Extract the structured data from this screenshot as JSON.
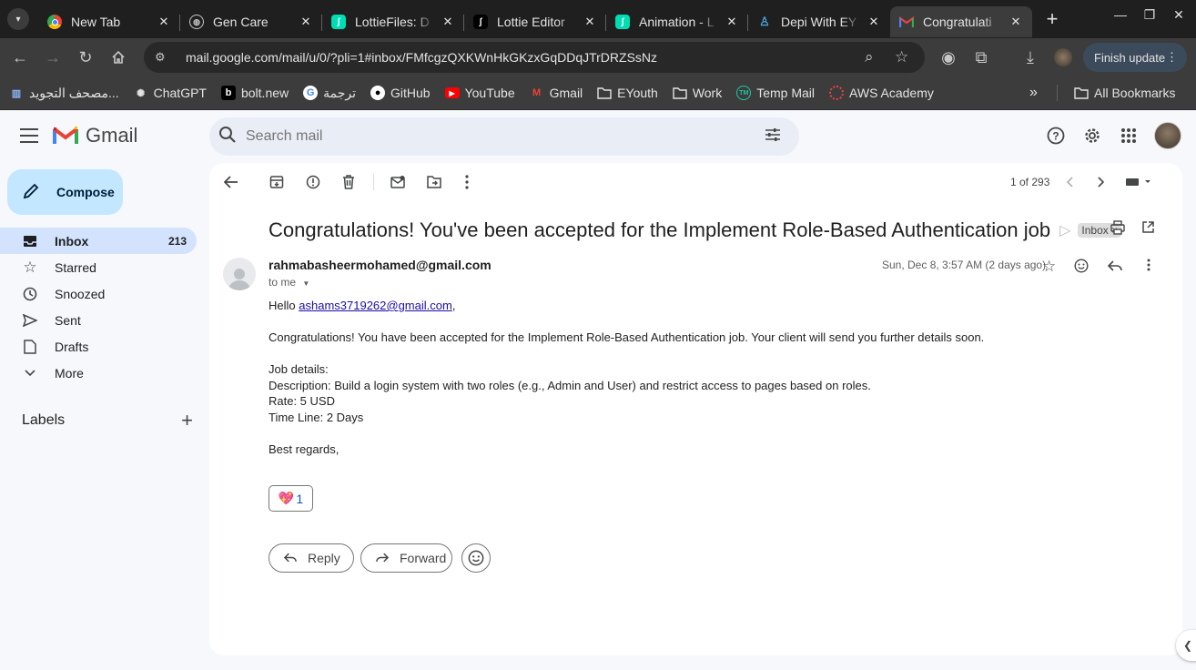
{
  "browser": {
    "tabs": [
      {
        "title": "New Tab",
        "icon": "chrome-icon"
      },
      {
        "title": "Gen Care",
        "icon": "globe-icon"
      },
      {
        "title": "LottieFiles: D",
        "icon": "lottie-icon"
      },
      {
        "title": "Lottie Editor",
        "icon": "lottie-editor-icon"
      },
      {
        "title": "Animation - L",
        "icon": "lottie-icon"
      },
      {
        "title": "Depi With EY",
        "icon": "depi-icon"
      },
      {
        "title": "Congratulati",
        "icon": "gmail-icon"
      }
    ],
    "url": "mail.google.com/mail/u/0/?pli=1#inbox/FMfcgzQXKWnHkGKzxGqDDqJTrDRZSsNz",
    "finish_update": "Finish update",
    "bookmarks": [
      {
        "label": "مصحف التجويد...",
        "icon": "book-icon"
      },
      {
        "label": "ChatGPT",
        "icon": "chatgpt-icon"
      },
      {
        "label": "bolt.new",
        "icon": "bolt-icon"
      },
      {
        "label": "ترجمة",
        "icon": "google-icon"
      },
      {
        "label": "GitHub",
        "icon": "github-icon"
      },
      {
        "label": "YouTube",
        "icon": "youtube-icon"
      },
      {
        "label": "Gmail",
        "icon": "gmail-icon"
      },
      {
        "label": "EYouth",
        "icon": "folder-icon"
      },
      {
        "label": "Work",
        "icon": "folder-icon"
      },
      {
        "label": "Temp Mail",
        "icon": "tempmail-icon"
      },
      {
        "label": "AWS Academy",
        "icon": "aws-icon"
      }
    ],
    "all_bookmarks": "All Bookmarks"
  },
  "gmail": {
    "logo_text": "Gmail",
    "search_placeholder": "Search mail",
    "compose_label": "Compose",
    "nav": [
      {
        "label": "Inbox",
        "count": "213",
        "icon": "inbox-icon"
      },
      {
        "label": "Starred",
        "count": "",
        "icon": "star-icon"
      },
      {
        "label": "Snoozed",
        "count": "",
        "icon": "clock-icon"
      },
      {
        "label": "Sent",
        "count": "",
        "icon": "send-icon"
      },
      {
        "label": "Drafts",
        "count": "",
        "icon": "draft-icon"
      },
      {
        "label": "More",
        "count": "",
        "icon": "chevron-down-icon"
      }
    ],
    "labels_heading": "Labels",
    "pager": "1 of 293",
    "message": {
      "subject": "Congratulations! You've been accepted for the Implement Role-Based Authentication job",
      "tag": "Inbox",
      "sender": "rahmabasheermohamed@gmail.com",
      "to": "to me",
      "date": "Sun, Dec 8, 3:57 AM (2 days ago)",
      "greeting_prefix": "Hello ",
      "greeting_email": "ashams3719262@gmail.com",
      "greeting_suffix": ",",
      "line1": "Congratulations! You have been accepted for the Implement Role-Based Authentication job. Your client will send you further details soon.",
      "details_heading": "Job details:",
      "description": "Description: Build a login system with two roles (e.g., Admin and User) and restrict access to pages based on roles.",
      "rate": "Rate: 5 USD",
      "timeline": "Time Line: 2 Days",
      "signoff": "Best regards,",
      "reaction_emoji": "💖",
      "reaction_count": "1"
    },
    "reply_label": "Reply",
    "forward_label": "Forward"
  }
}
